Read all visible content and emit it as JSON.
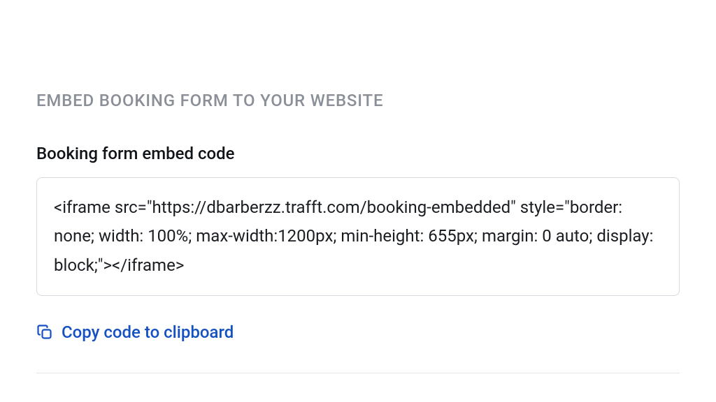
{
  "section": {
    "heading": "EMBED BOOKING FORM TO YOUR WEBSITE",
    "label": "Booking form embed code",
    "embed_code": "<iframe src=\"https://dbarberzz.trafft.com/booking-embedded\" style=\"border: none; width: 100%; max-width:1200px; min-height: 655px; margin: 0 auto; display: block;\"></iframe>",
    "copy_label": "Copy code to clipboard"
  },
  "colors": {
    "heading_muted": "#8a8f98",
    "text_primary": "#101418",
    "border": "#d6d9de",
    "accent": "#1551c2",
    "divider": "#e2e5ea"
  }
}
